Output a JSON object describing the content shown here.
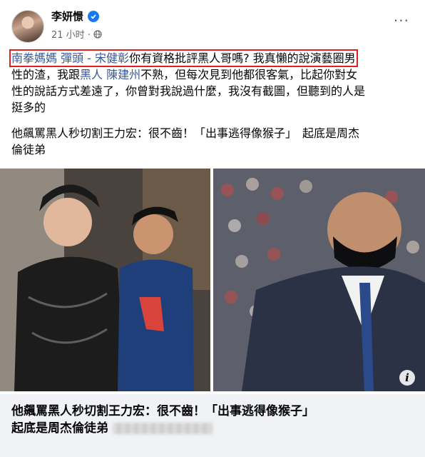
{
  "post": {
    "author": "李妍憬",
    "time": "21 小时 ·",
    "text": {
      "link1": "南拳媽媽 彈頭",
      "sep": " - ",
      "link2": "宋健彰",
      "line1_rest": "你有資格批評黑人哥嗎? 我真懶的說演藝圈男",
      "line2_a": "性的渣，我跟",
      "link3": "黑人",
      "line2_sp": " ",
      "link4": "陳建州",
      "line2_b": "不熟，但每次見到他都很客氣，比起你對女",
      "line3": "性的說話方式差遠了，你曾對我說過什麼，我沒有截圖，但聽到的人是",
      "line4": "挺多的",
      "para2_line1": "他飆罵黑人秒切割王力宏：很不齒！「出事逃得像猴子」　起底是周杰",
      "para2_line2": "倫徒弟"
    }
  },
  "link_preview": {
    "title_line1": "他飆罵黑人秒切割王力宏：很不齒！「出事逃得像猴子」",
    "title_line2": "起底是周杰倫徒弟"
  },
  "colors": {
    "link": "#385898",
    "verified": "#1877f2",
    "highlight": "#e02020"
  },
  "icons": [
    "verified-icon",
    "globe-icon",
    "more-options-icon",
    "info-icon"
  ]
}
